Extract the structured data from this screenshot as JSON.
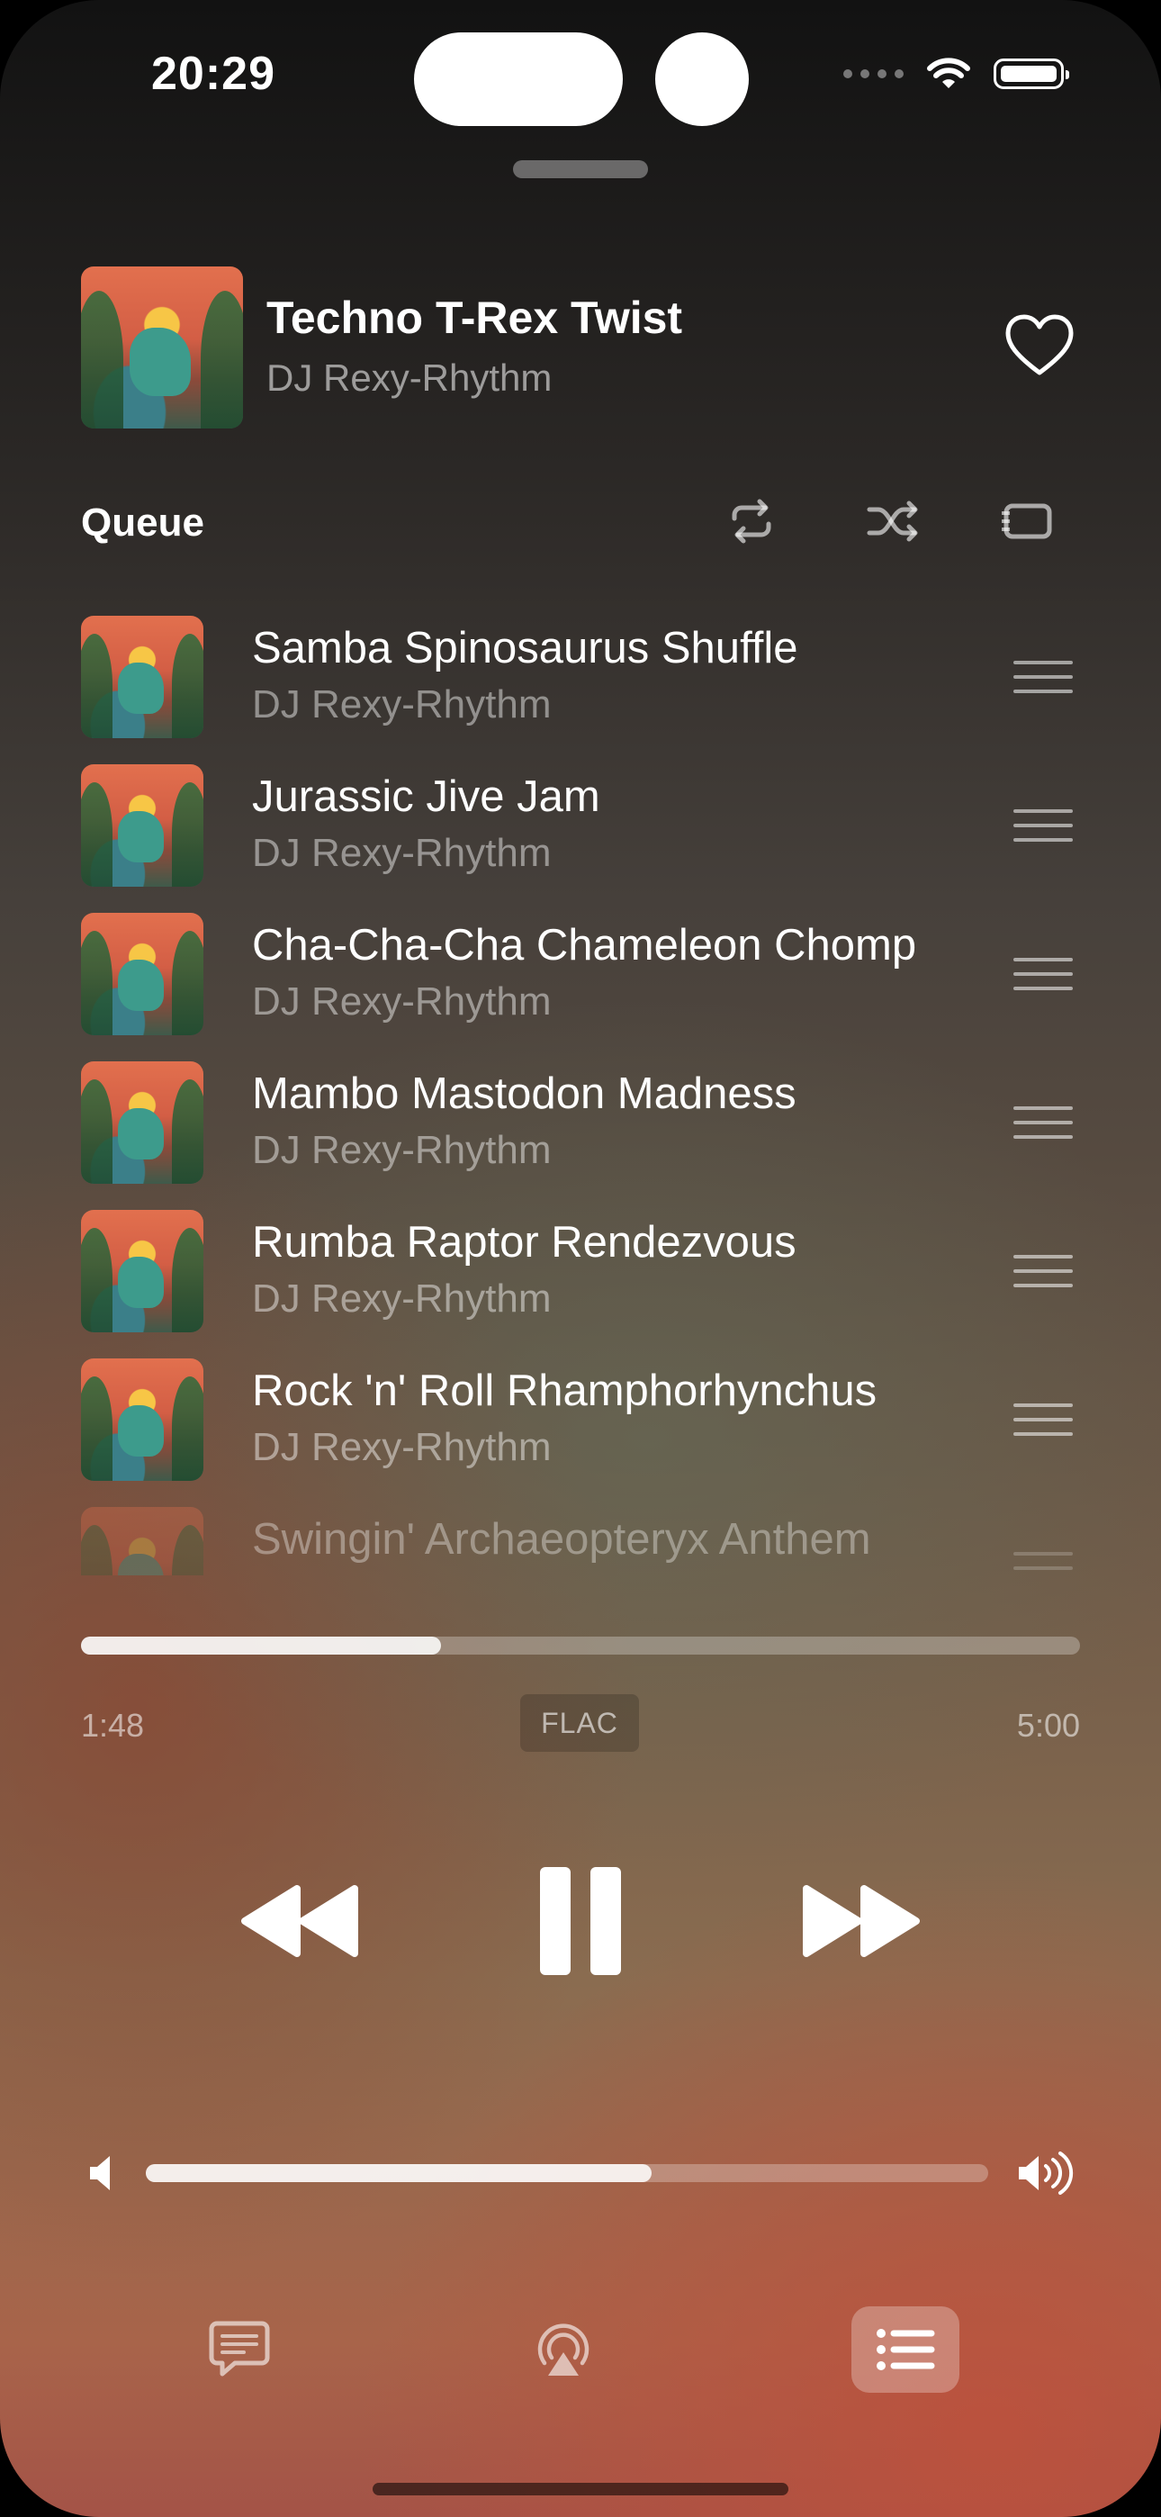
{
  "status_bar": {
    "time": "20:29"
  },
  "now_playing": {
    "title": "Techno T-Rex Twist",
    "artist": "DJ Rexy-Rhythm",
    "favorite_icon": "heart-outline-icon"
  },
  "queue": {
    "label": "Queue",
    "actions": [
      "repeat-icon",
      "shuffle-icon",
      "autoplay-icon"
    ],
    "items": [
      {
        "title": "Samba Spinosaurus Shuffle",
        "artist": "DJ Rexy-Rhythm"
      },
      {
        "title": "Jurassic Jive Jam",
        "artist": "DJ Rexy-Rhythm"
      },
      {
        "title": "Cha-Cha-Cha Chameleon Chomp",
        "artist": "DJ Rexy-Rhythm"
      },
      {
        "title": "Mambo Mastodon Madness",
        "artist": "DJ Rexy-Rhythm"
      },
      {
        "title": "Rumba Raptor Rendezvous",
        "artist": "DJ Rexy-Rhythm"
      },
      {
        "title": "Rock 'n' Roll Rhamphorhynchus",
        "artist": "DJ Rexy-Rhythm"
      },
      {
        "title": "Swingin' Archaeopteryx Anthem",
        "artist": ""
      }
    ]
  },
  "playback": {
    "elapsed": "1:48",
    "total": "5:00",
    "progress_fraction": 0.36,
    "format_badge": "FLAC"
  },
  "volume": {
    "level_fraction": 0.6
  },
  "bottom_bar": {
    "items": [
      "lyrics-icon",
      "airplay-audio-icon",
      "queue-list-icon"
    ],
    "active": "queue-list-icon"
  }
}
